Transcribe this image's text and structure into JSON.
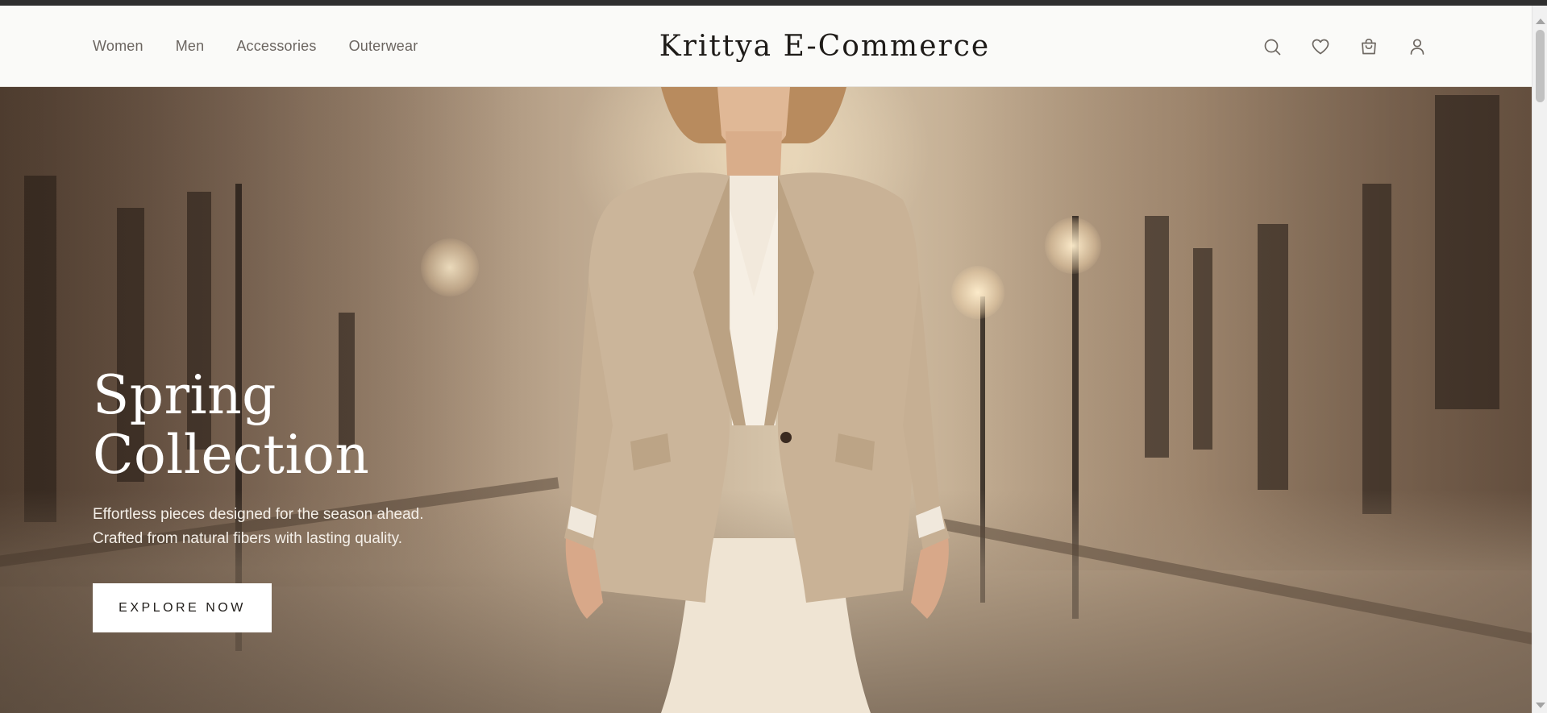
{
  "nav": {
    "links": [
      "Women",
      "Men",
      "Accessories",
      "Outerwear"
    ],
    "brand": "Krittya E-Commerce",
    "icons": [
      "search-icon",
      "heart-icon",
      "shopping-bag-icon",
      "user-icon"
    ]
  },
  "hero": {
    "title_line1": "Spring",
    "title_line2": "Collection",
    "desc_line1": "Effortless pieces designed for the season ahead.",
    "desc_line2": "Crafted from natural fibers with lasting quality.",
    "cta_label": "EXPLORE NOW"
  },
  "colors": {
    "nav_bg": "#fafaf8",
    "brand_text": "#1e1b18",
    "nav_link": "#6b6560",
    "cta_bg": "#ffffff",
    "cta_text": "#1f1c19",
    "hero_text": "#ffffff"
  }
}
